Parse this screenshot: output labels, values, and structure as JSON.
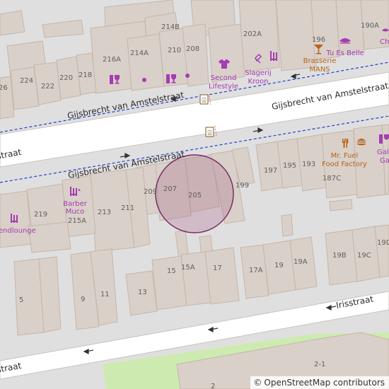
{
  "map": {
    "streets": {
      "upper_sidewalk": "Gijsbrecht van Amstelstraat",
      "main_road": "Gijsbrecht van Amstelstraat",
      "main_road_left": "straat",
      "lower_sidewalk": "Gijsbrecht van Amstelstraat",
      "irisstraat": "Irisstraat",
      "irisstraat_left": "straat"
    },
    "house_numbers": {
      "n214B": "214B",
      "n216A": "216A",
      "n214A": "214A",
      "n210": "210",
      "n208": "208",
      "n202A": "202A",
      "n196": "196",
      "n190A": "190A",
      "n224": "224",
      "n222": "222",
      "n220": "220",
      "n218": "218",
      "n26": "26",
      "n207": "207",
      "n205": "205",
      "n209": "209",
      "n199": "199",
      "n197": "197",
      "n195": "195",
      "n193": "193",
      "n187C": "187C",
      "n219": "219",
      "n213": "213",
      "n211": "211",
      "n215A": "215A",
      "n15": "15",
      "n15A": "15A",
      "n17": "17",
      "n17A": "17A",
      "n19": "19",
      "n19A": "19A",
      "n19B": "19B",
      "n19C": "19C",
      "n19D": "19D",
      "n5": "5",
      "n9": "9",
      "n11": "11",
      "n13": "13",
      "n21": "2-1",
      "n2": "2"
    },
    "pois": {
      "second_lifestyle_1": "Second",
      "second_lifestyle_2": "Lifestyle",
      "slagerij_1": "Slagerij",
      "slagerij_2": "Kroon",
      "tu_es_belle": "Tu Es Belle",
      "brasserie_1": "Brasserie",
      "brasserie_2": "MANS",
      "ch": "Ch",
      "barber_1": "Barber",
      "barber_2": "Muco",
      "rendlounge": "rendlounge",
      "mr_fuel_1": "Mr. Fuel",
      "mr_fuel_2": "Food Factory",
      "gall_1": "Gall",
      "gall_2": "Gal"
    },
    "colors": {
      "background": "#e0dfdf",
      "building": "#d9d0c9",
      "building_outline": "#c4b6ab",
      "road": "#ffffff",
      "road_casing": "#c9c3bd",
      "sidewalk_dash": "#1f3fcf",
      "poi_purple": "#a63cb0",
      "poi_orange": "#b6641c",
      "highlight_fill": "#a0557f",
      "highlight_stroke": "#7a2d63",
      "grass": "#cdebb0"
    },
    "icons": [
      "shop-icon",
      "wine-shop-icon",
      "clothes-shop-icon",
      "butcher-icon",
      "hairdresser-icon",
      "cosmetics-icon",
      "cocktail-bar-icon",
      "restaurant-icon",
      "fast-food-icon",
      "bus-stop-icon",
      "direction-arrow-icon"
    ]
  },
  "attribution": {
    "symbol": "©",
    "text": "OpenStreetMap contributors"
  }
}
